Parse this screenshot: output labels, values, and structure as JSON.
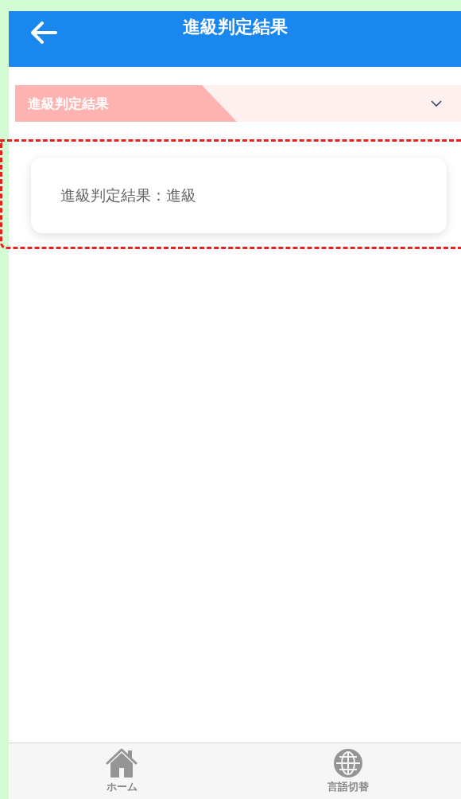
{
  "header": {
    "title": "進級判定結果"
  },
  "section": {
    "title": "進級判定結果",
    "expanded": true
  },
  "card": {
    "text": "進級判定結果：進級"
  },
  "bottom_nav": [
    {
      "label": "ホーム",
      "kind": "home"
    },
    {
      "label": "言語切替",
      "kind": "language"
    }
  ]
}
